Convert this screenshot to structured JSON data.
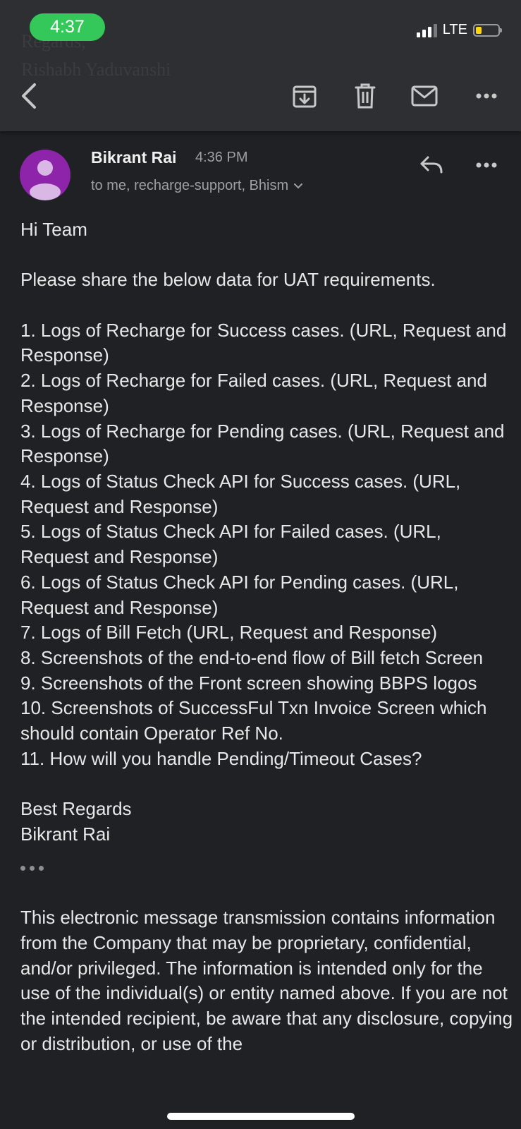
{
  "status_bar": {
    "time": "4:37",
    "network": "LTE",
    "pill_color": "#34c759",
    "battery_color": "#ffd60a"
  },
  "background_ghost": {
    "line1": "Regards,",
    "line2": "Rishabh Yaduvanshi"
  },
  "toolbar": {
    "back_icon": "chevron-left-icon",
    "archive_icon": "archive-icon",
    "delete_icon": "trash-icon",
    "mark_unread_icon": "mail-icon",
    "more_icon": "more-horizontal-icon"
  },
  "message": {
    "sender": "Bikrant Rai",
    "time": "4:36 PM",
    "recipients": "to me, recharge-support, Bhism",
    "avatar_color": "#8e24aa",
    "greeting": "Hi Team",
    "intro": "Please share the below data for UAT requirements.",
    "items": [
      "1. Logs of Recharge for Success cases. (URL, Request and Response)",
      "2. Logs of Recharge for Failed cases. (URL, Request and Response)",
      "3. Logs of Recharge for Pending cases. (URL, Request and Response)",
      "4. Logs of Status Check API for Success cases. (URL, Request and Response)",
      "5. Logs of Status Check API for Failed cases. (URL, Request and Response)",
      "6. Logs of Status Check API for Pending cases. (URL, Request and Response)",
      "7. Logs of Bill Fetch (URL, Request and Response)",
      "8. Screenshots of the end-to-end flow of Bill fetch Screen",
      "9. Screenshots of the Front screen showing BBPS logos",
      "10. Screenshots of SuccessFul Txn Invoice Screen which should contain Operator Ref No.",
      "11. How will you handle Pending/Timeout Cases?"
    ],
    "signoff": "Best Regards",
    "signature": "Bikrant Rai",
    "disclaimer": "This electronic message transmission contains information from the Company that may be proprietary, confidential, and/or privileged. The information is intended only for the use of the individual(s) or entity named above. If you are not the intended recipient, be aware that any disclosure, copying or distribution, or use of the"
  }
}
